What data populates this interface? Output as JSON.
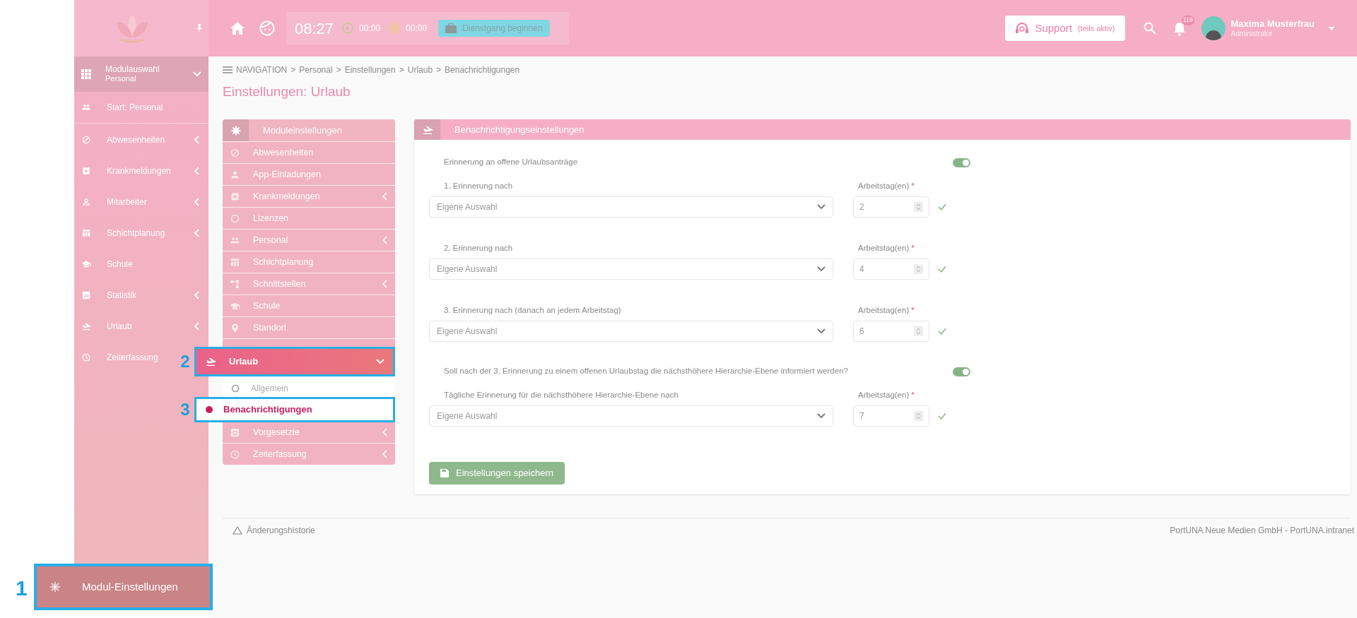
{
  "header": {
    "clock": "08:27",
    "timers": [
      "00:00",
      "00:00"
    ],
    "shift_button": "Dienstgang beginnen",
    "support": {
      "label": "Support",
      "note": "(teils aktiv)"
    },
    "notifications": "119",
    "user": {
      "name": "Maxima Musterfrau",
      "role": "Administrator"
    }
  },
  "sidebar": {
    "module_select": {
      "label": "Modulauswahl",
      "sub": "Personal"
    },
    "items": [
      {
        "label": "Start: Personal",
        "has_submenu": false
      },
      {
        "label": "Abwesenheiten",
        "has_submenu": true
      },
      {
        "label": "Krankmeldungen",
        "has_submenu": true
      },
      {
        "label": "Mitarbeiter",
        "has_submenu": true
      },
      {
        "label": "Schichtplanung",
        "has_submenu": true
      },
      {
        "label": "Schule",
        "has_submenu": false
      },
      {
        "label": "Statistik",
        "has_submenu": true
      },
      {
        "label": "Urlaub",
        "has_submenu": true
      },
      {
        "label": "Zeiterfassung",
        "has_submenu": false
      }
    ],
    "settings_button": {
      "label": "Modul-Einstellungen",
      "callout": "1"
    }
  },
  "breadcrumb": {
    "root": "NAVIGATION",
    "separator": ">",
    "items": [
      "Personal",
      "Einstellungen",
      "Urlaub",
      "Benachrichtigungen"
    ]
  },
  "page_title": "Einstellungen: Urlaub",
  "settings_menu": {
    "title": "Moduleinstellungen",
    "items": [
      {
        "kind": "item",
        "label": "Abwesenheiten",
        "has_submenu": false
      },
      {
        "kind": "item",
        "label": "App-Einladungen",
        "has_submenu": false
      },
      {
        "kind": "item",
        "label": "Krankmeldungen",
        "has_submenu": true
      },
      {
        "kind": "item",
        "label": "Lizenzen",
        "has_submenu": false
      },
      {
        "kind": "item",
        "label": "Personal",
        "has_submenu": true
      },
      {
        "kind": "item",
        "label": "Schichtplanung",
        "has_submenu": false
      },
      {
        "kind": "item",
        "label": "Schnittstellen",
        "has_submenu": true
      },
      {
        "kind": "item",
        "label": "Schule",
        "has_submenu": false
      },
      {
        "kind": "item",
        "label": "Standort",
        "has_submenu": false
      },
      {
        "kind": "group",
        "label": "Urlaub",
        "expanded": true,
        "callout": "2",
        "children": [
          {
            "label": "Allgemein",
            "selected": false
          },
          {
            "label": "Benachrichtigungen",
            "selected": true,
            "callout": "3"
          }
        ]
      },
      {
        "kind": "item",
        "label": "Vorgesetzte",
        "has_submenu": true
      },
      {
        "kind": "item",
        "label": "Zeiterfassung",
        "has_submenu": true
      }
    ]
  },
  "card": {
    "title": "Benachrichtigungseinstellungen",
    "rows": [
      {
        "kind": "toggle",
        "label": "Erinnerung an offene Urlaubsanträge",
        "on": true
      },
      {
        "kind": "select",
        "label": "1. Erinnerung nach",
        "value": "Eigene Auswahl",
        "days_label": "Arbeitstag(en)",
        "required_mark": "*",
        "days": "2",
        "valid": true
      },
      {
        "kind": "select",
        "label": "2. Erinnerung nach",
        "value": "Eigene Auswahl",
        "days_label": "Arbeitstag(en)",
        "required_mark": "*",
        "days": "4",
        "valid": true
      },
      {
        "kind": "select",
        "label": "3. Erinnerung nach (danach an jedem Arbeitstag)",
        "value": "Eigene Auswahl",
        "days_label": "Arbeitstag(en)",
        "required_mark": "*",
        "days": "6",
        "valid": true
      },
      {
        "kind": "toggle",
        "label": "Soll nach der 3. Erinnerung zu einem offenen Urlaubstag die nächsthöhere Hierarchie-Ebene informiert werden?",
        "on": true
      },
      {
        "kind": "select",
        "label": "Tägliche Erinnerung für die nächsthöhere Hierarchie-Ebene nach",
        "value": "Eigene Auswahl",
        "days_label": "Arbeitstag(en)",
        "required_mark": "*",
        "days": "7",
        "valid": true
      }
    ],
    "save_button": "Einstellungen speichern"
  },
  "footer": {
    "history": "Änderungshistorie",
    "copyright": "PortUNA Neue Medien GmbH - PortUNA.intranet"
  }
}
